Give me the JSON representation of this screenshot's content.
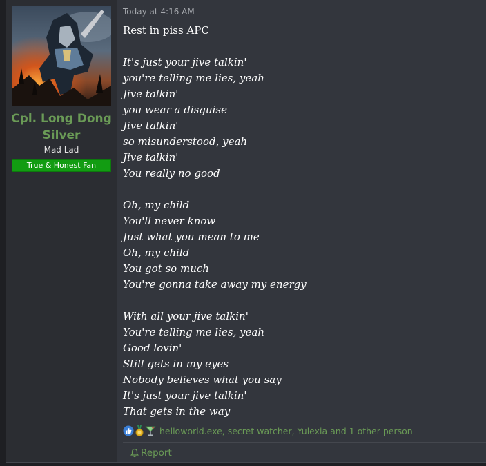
{
  "user": {
    "name": "Cpl. Long Dong Silver",
    "title": "Mad Lad",
    "banner": "True & Honest Fan"
  },
  "post": {
    "timestamp": "Today at 4:16 AM",
    "first_line": "Rest in piss APC",
    "lyrics": [
      "It's just your jive talkin'",
      "you're telling me lies, yeah",
      "Jive talkin'",
      "you wear a disguise",
      "Jive talkin'",
      "so misunderstood, yeah",
      "Jive talkin'",
      "You really no good",
      "",
      "Oh, my child",
      "You'll never know",
      "Just what you mean to me",
      "Oh, my child",
      "You got so much",
      "You're gonna take away my energy",
      "",
      "With all your jive talkin'",
      "You're telling me lies, yeah",
      "Good lovin'",
      "Still gets in my eyes",
      "Nobody believes what you say",
      "It's just your jive talkin'",
      "That gets in the way"
    ]
  },
  "reactions": {
    "icons": [
      "like-icon",
      "winner-medal-icon",
      "cocktail-icon"
    ],
    "users_text": "helloworld.exe, secret watcher, Yulexia and 1 other person"
  },
  "footer": {
    "report_label": "Report"
  },
  "colors": {
    "username": "#6a9a56",
    "banner": "#129c12",
    "post_bg": "#33363d",
    "sidebar_bg": "#2b2d32"
  }
}
